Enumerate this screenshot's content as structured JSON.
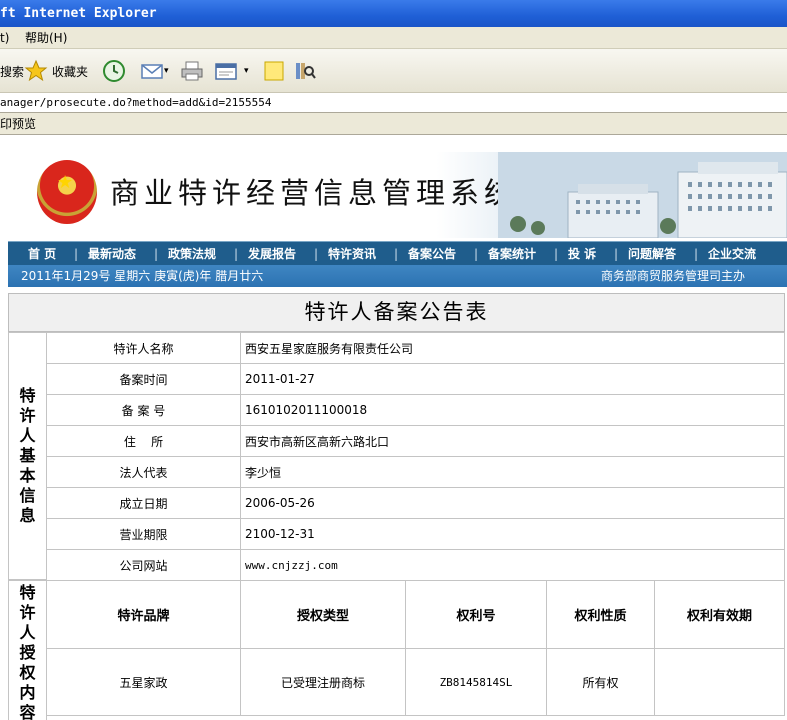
{
  "window": {
    "title": "ft Internet Explorer"
  },
  "menu": {
    "items": [
      "t)",
      "帮助(H)"
    ]
  },
  "toolbar": {
    "search_label": "搜索",
    "favorites_label": "收藏夹"
  },
  "address": {
    "url": "anager/prosecute.do?method=add&id=2155554"
  },
  "printbar": {
    "label": "印预览"
  },
  "site": {
    "title": "商业特许经营信息管理系统",
    "nav": [
      "首  页",
      "最新动态",
      "政策法规",
      "发展报告",
      "特许资讯",
      "备案公告",
      "备案统计",
      "投  诉",
      "问题解答",
      "企业交流"
    ],
    "nav_sep": "|",
    "date": "2011年1月29号 星期六 庚寅(虎)年 腊月廿六",
    "sponsor": "商务部商贸服务管理司主办"
  },
  "record": {
    "table_title": "特许人备案公告表",
    "section_basic": "特许人基本信息",
    "section_auth": "特许人授权内容",
    "basic": [
      {
        "label": "特许人名称",
        "value": "西安五星家庭服务有限责任公司"
      },
      {
        "label": "备案时间",
        "value": "2011-01-27"
      },
      {
        "label": "备 案 号",
        "value": "1610102011100018"
      },
      {
        "label": "住    所",
        "value": "西安市高新区高新六路北口"
      },
      {
        "label": "法人代表",
        "value": "李少恒"
      },
      {
        "label": "成立日期",
        "value": "2006-05-26"
      },
      {
        "label": "营业期限",
        "value": "2100-12-31"
      },
      {
        "label": "公司网站",
        "value": "www.cnjzzj.com"
      }
    ],
    "auth_headers": [
      "特许品牌",
      "授权类型",
      "权利号",
      "权利性质",
      "权利有效期"
    ],
    "auth_rows": [
      [
        "五星家政",
        "已受理注册商标",
        "ZB8145814SL",
        "所有权",
        ""
      ]
    ]
  },
  "colors": {
    "nav_bg": "#1f5d8c",
    "date_bg": "#2c72b2",
    "titlebar": "#1f5fd6"
  }
}
